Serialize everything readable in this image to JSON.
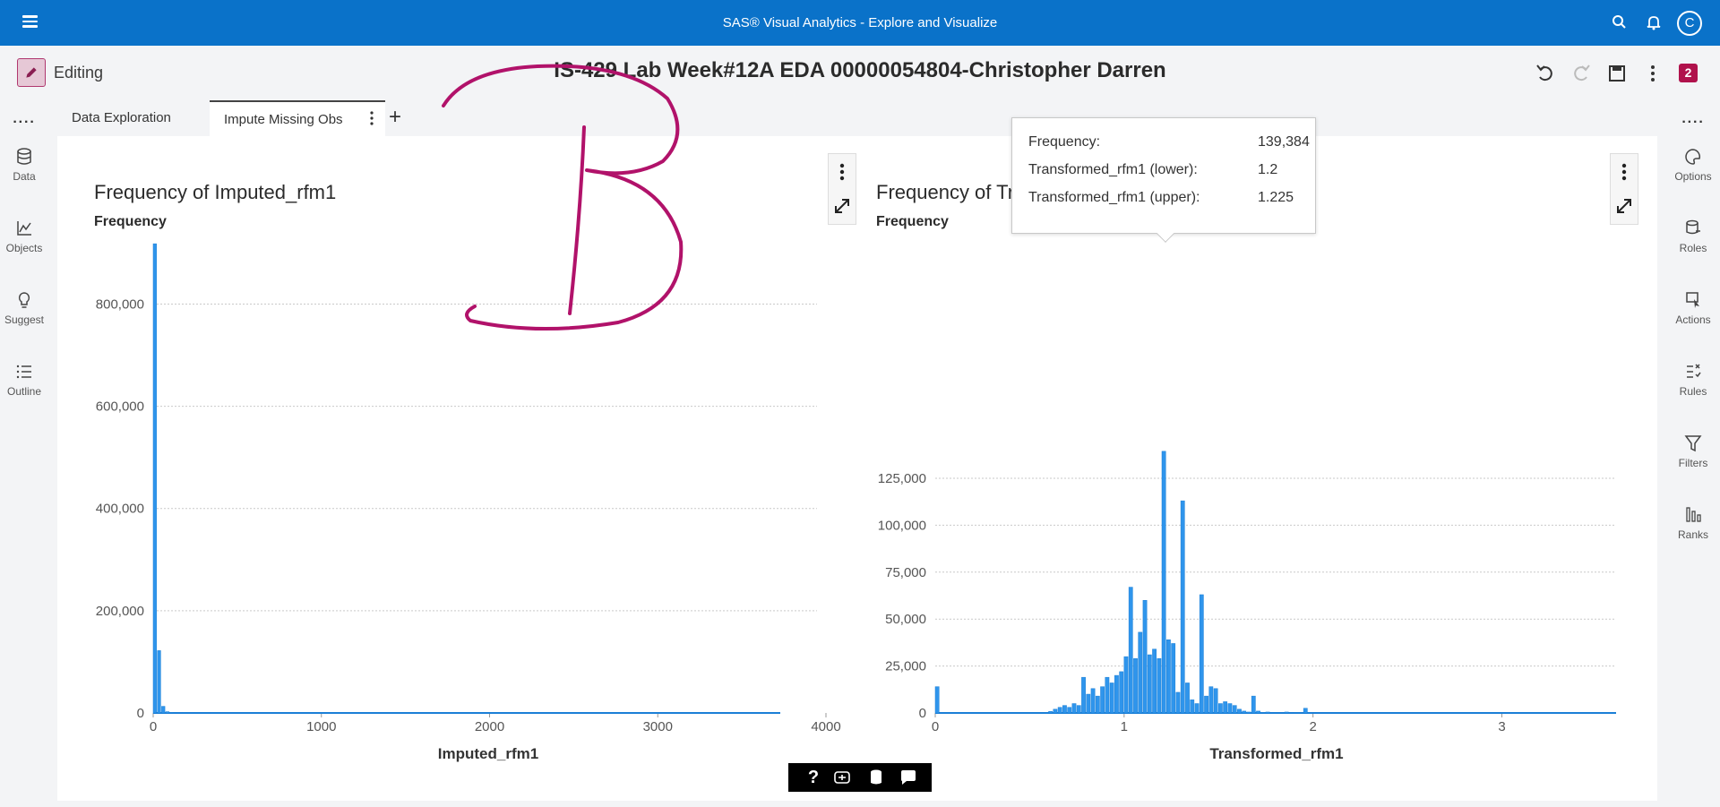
{
  "topbar": {
    "app_title": "SAS® Visual Analytics - Explore and Visualize",
    "avatar_letter": "C"
  },
  "editbar": {
    "mode_label": "Editing",
    "report_title": "IS-429 Lab Week#12A EDA 00000054804-Christopher Darren",
    "badge_count": "2"
  },
  "left_rail": {
    "items": [
      {
        "label": "Data",
        "icon": "database-icon"
      },
      {
        "label": "Objects",
        "icon": "line-chart-icon"
      },
      {
        "label": "Suggest",
        "icon": "lightbulb-icon"
      },
      {
        "label": "Outline",
        "icon": "list-icon"
      }
    ]
  },
  "right_rail": {
    "items": [
      {
        "label": "Options",
        "icon": "palette-icon"
      },
      {
        "label": "Roles",
        "icon": "roles-icon"
      },
      {
        "label": "Actions",
        "icon": "cursor-icon"
      },
      {
        "label": "Rules",
        "icon": "rules-icon"
      },
      {
        "label": "Filters",
        "icon": "funnel-icon"
      },
      {
        "label": "Ranks",
        "icon": "bars-icon"
      }
    ]
  },
  "tabs": [
    {
      "label": "Data Exploration",
      "active": false
    },
    {
      "label": "Impute Missing Obs",
      "active": true
    }
  ],
  "colors": {
    "topbar": "#0a72c9",
    "bars": "#2f95ec",
    "bar_stroke": "#1b7fd6",
    "accent_magenta": "#b0124c",
    "annotation": "#b1126a"
  },
  "chart_data": [
    {
      "type": "bar",
      "title": "Frequency of Imputed_rfm1",
      "ylabel": "Frequency",
      "xlabel": "Imputed_rfm1",
      "ylim": [
        0,
        920000
      ],
      "xlim": [
        0,
        4000
      ],
      "x_ticks": [
        "0",
        "1000",
        "2000",
        "3000",
        "4000"
      ],
      "y_ticks": [
        "0",
        "200,000",
        "400,000",
        "600,000",
        "800,000"
      ],
      "bin_width": 25,
      "x_start": 0,
      "values": [
        918000,
        122000,
        13000,
        2500,
        1000,
        500,
        300,
        200,
        100,
        80,
        60,
        40,
        30,
        20
      ]
    },
    {
      "type": "bar",
      "title": "Frequency of Transformed_rfm1",
      "ylabel": "Frequency",
      "xlabel": "Transformed_rfm1",
      "ylim": [
        0,
        139384
      ],
      "xlim": [
        0,
        3.6
      ],
      "x_ticks": [
        "0",
        "1",
        "2",
        "3"
      ],
      "y_ticks": [
        "0",
        "25,000",
        "50,000",
        "75,000",
        "100,000",
        "125,000"
      ],
      "bin_width": 0.025,
      "x_start": 0,
      "values": [
        14000,
        0,
        0,
        0,
        0,
        0,
        0,
        0,
        0,
        0,
        0,
        0,
        0,
        0,
        0,
        0,
        0,
        0,
        0,
        0,
        0,
        0,
        0,
        0,
        800,
        2000,
        3000,
        4000,
        3000,
        5000,
        4000,
        19000,
        10000,
        13000,
        9000,
        14000,
        19000,
        16000,
        20000,
        22000,
        30000,
        67000,
        29000,
        43000,
        60000,
        31000,
        34000,
        29000,
        139384,
        39000,
        37000,
        11000,
        113000,
        16000,
        7000,
        5000,
        63000,
        9000,
        14000,
        13000,
        5000,
        6000,
        5000,
        4000,
        2000,
        1000,
        500,
        9000,
        1000,
        300,
        500,
        200,
        200,
        200,
        500,
        200,
        0,
        0,
        2500,
        0,
        0,
        0,
        0,
        0
      ]
    }
  ],
  "tooltip": {
    "freq_label": "Frequency:",
    "freq_value": "139,384",
    "lower_label": "Transformed_rfm1 (lower):",
    "lower_value": "1.2",
    "upper_label": "Transformed_rfm1 (upper):",
    "upper_value": "1.225"
  },
  "bottom_tools": {
    "help": "?",
    "icons": [
      "accessibility-icon",
      "data-icon",
      "chat-icon"
    ]
  }
}
